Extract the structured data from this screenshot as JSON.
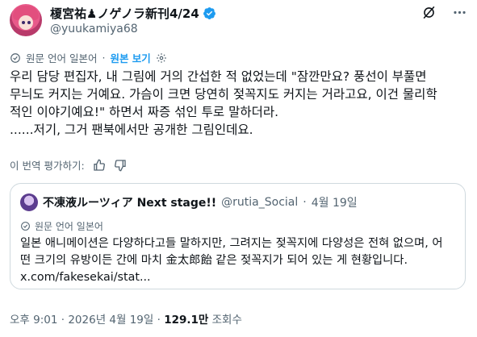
{
  "author": {
    "display_name": "榎宮祐♟ノゲノラ新刊4/24",
    "handle": "@yuukamiya68"
  },
  "translation_bar": {
    "label": "원문 언어 일본어",
    "show_original": "원본 보기"
  },
  "post": {
    "lines": [
      "우리 담당 편집자, 내 그림에 거의 간섭한 적 없었는데 \"잠깐만요? 풍선이 부풀면",
      "무늬도 커지는 거예요. 가슴이 크면 당연히 젖꼭지도 커지는 거라고요, 이건 물리학",
      "적인 이야기예요!\" 하면서 짜증 섞인 투로 말하더라.",
      "......저기, 그거 팬북에서만 공개한 그림인데요."
    ]
  },
  "rate_translation": {
    "label": "이 번역 평가하기:"
  },
  "quote": {
    "display_name": "不凍液ルーツィア Next stage!!",
    "handle": "@rutia_Social",
    "separator": "·",
    "date": "4월 19일",
    "translation_label": "원문 언어 일본어",
    "lines": [
      "일본 애니메이션은 다양하다고들 말하지만, 그려지는 젖꼭지에 다양성은 전혀 없으며, 어",
      "떤 크기의 유방이든 간에 마치 金太郎飴 같은 젖꼭지가 되어 있는 게 현황입니다.",
      "x.com/fakesekai/stat..."
    ]
  },
  "footer": {
    "time": "오후 9:01",
    "separator": "·",
    "date": "2026년 4월 19일",
    "views": "129.1만",
    "views_label": "조회수"
  },
  "colors": {
    "accent": "#1d9bf0",
    "secondary_text": "#536471",
    "border": "#cfd9de"
  }
}
